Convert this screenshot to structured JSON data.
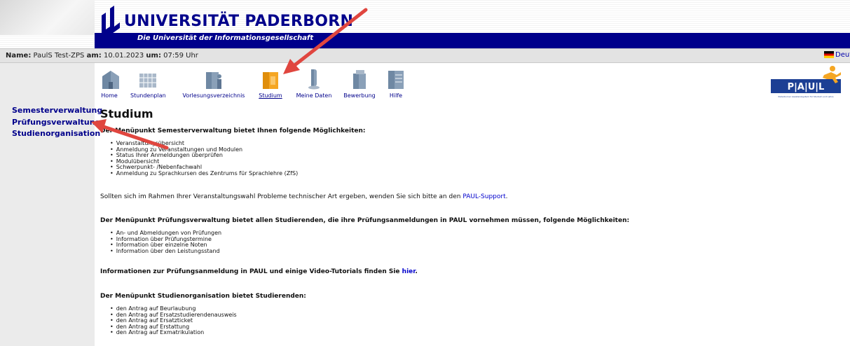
{
  "header": {
    "university_name": "UNIVERSITÄT PADERBORN",
    "tagline": "Die Universität der Informationsgesellschaft"
  },
  "infobar": {
    "name_label": "Name:",
    "name_value": "PaulS Test-ZPS",
    "date_label": "am:",
    "date_value": "10.01.2023",
    "time_label": "um:",
    "time_value": "07:59 Uhr",
    "language_link": "Deuts"
  },
  "nav": {
    "items": [
      {
        "label": "Home",
        "icon": "building-icon"
      },
      {
        "label": "Stundenplan",
        "icon": "calendar-grid-icon"
      },
      {
        "label": "Vorlesungsverzeichnis",
        "icon": "lecture-hall-icon"
      },
      {
        "label": "Studium",
        "icon": "study-books-icon",
        "active": true
      },
      {
        "label": "Meine Daten",
        "icon": "person-data-icon"
      },
      {
        "label": "Bewerbung",
        "icon": "application-icon"
      },
      {
        "label": "Hilfe",
        "icon": "help-icon"
      }
    ]
  },
  "sidebar": {
    "items": [
      {
        "label": "Semesterverwaltung"
      },
      {
        "label": "Prüfungsverwaltung"
      },
      {
        "label": "Studienorganisation"
      }
    ]
  },
  "paul_logo": {
    "text": "P|A|U|L",
    "subtitle": "Paderborner Assistenzsystem für Studium und Lehre"
  },
  "content": {
    "title": "Studium",
    "section1_intro": "Der Menüpunkt Semesterverwaltung bietet Ihnen folgende Möglichkeiten:",
    "section1_items": [
      "Veranstaltungsübersicht",
      "Anmeldung zu Veranstaltungen und Modulen",
      "Status Ihrer Anmeldungen überprüfen",
      "Modulübersicht",
      "Schwerpunkt- /Nebenfachwahl",
      "Anmeldung zu Sprachkursen des Zentrums für Sprachlehre (ZfS)"
    ],
    "support_text": "Sollten sich im Rahmen Ihrer Veranstaltungswahl Probleme technischer Art ergeben, wenden Sie sich bitte an den",
    "support_link": "PAUL-Support",
    "support_end": ".",
    "section2_intro": "Der Menüpunkt Prüfungsverwaltung bietet allen Studierenden, die ihre Prüfungsanmeldungen in PAUL vornehmen müssen, folgende Möglichkeiten:",
    "section2_items": [
      "An- und Abmeldungen von Prüfungen",
      "Information über Prüfungstermine",
      "Information über einzelne Noten",
      "Information über den Leistungsstand"
    ],
    "tutorial_text": "Informationen zur Prüfungsanmeldung in PAUL und einige Video-Tutorials finden Sie",
    "tutorial_link": "hier",
    "tutorial_end": ".",
    "section3_intro": "Der Menüpunkt Studienorganisation bietet Studierenden:",
    "section3_items": [
      "den Antrag auf Beurlaubung",
      "den Antrag auf Ersatzstudierendenausweis",
      "den Antrag auf Ersatzticket",
      "den Antrag auf Erstattung",
      "den Antrag auf Exmatrikulation"
    ]
  },
  "colors": {
    "brand_blue": "#00008b",
    "arrow_red": "#e0463f",
    "active_icon": "#f5a623"
  }
}
